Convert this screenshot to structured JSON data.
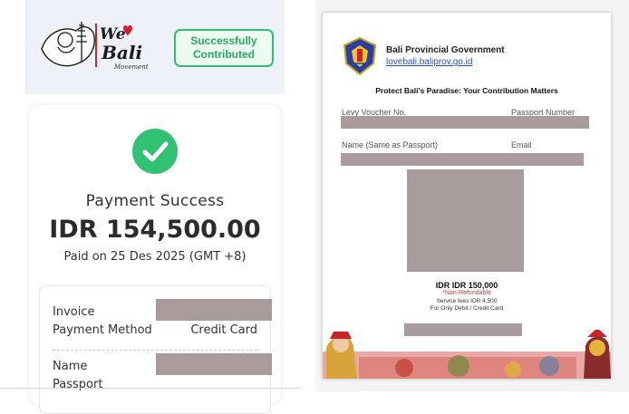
{
  "header": {
    "logo": {
      "line1": "We",
      "line2": "Bali",
      "tagline": "Movement"
    },
    "status_badge": "Successfully Contributed"
  },
  "payment": {
    "status": "Payment Success",
    "amount": "IDR 154,500.00",
    "paid_on": "Paid on 25 Des 2025 (GMT +8)",
    "details": {
      "invoice_label": "Invoice",
      "method_label": "Payment Method",
      "method_value": "Credit Card",
      "name_label": "Name",
      "passport_label": "Passport"
    }
  },
  "document": {
    "gov_name": "Bali Provincial Government",
    "gov_link": "lovebali.baliprov.go.id",
    "title": "Protect Bali's Paradise: Your Contribution Matters",
    "fields": {
      "voucher": "Levy Voucher No.",
      "passport": "Passport Number",
      "name": "Name (Same as Passport)",
      "email": "Email"
    },
    "price": "IDR IDR 150,000",
    "non_refundable": "*Non-Refundable",
    "service_fee": "Service fees IDR 4,500",
    "payment_note": "For Only Debit / Credit Card"
  },
  "colors": {
    "success_green": "#30c172",
    "redaction": "#a99b9c",
    "link_blue": "#2b4fc8",
    "header_bg": "#eef1f8"
  }
}
